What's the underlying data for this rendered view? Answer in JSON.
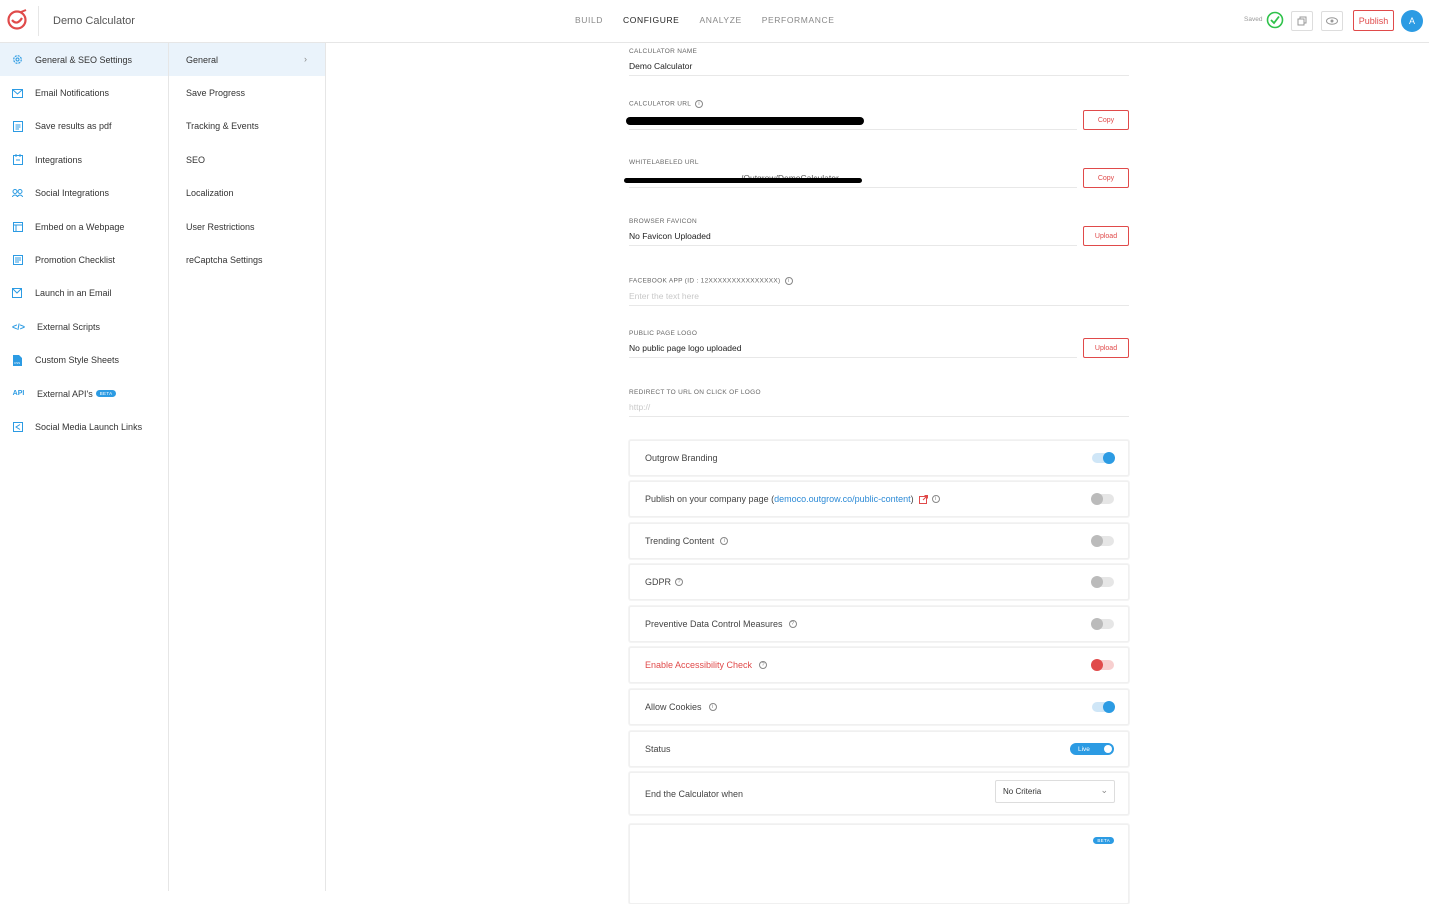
{
  "app": {
    "title": "Demo Calculator"
  },
  "nav": {
    "tabs": [
      "BUILD",
      "CONFIGURE",
      "ANALYZE",
      "PERFORMANCE"
    ],
    "active": "CONFIGURE"
  },
  "status": {
    "saved": "Saved"
  },
  "actions": {
    "publish": "Publish",
    "avatar": "A"
  },
  "sidebar": {
    "items": [
      {
        "label": "General & SEO Settings",
        "icon": "gear-icon"
      },
      {
        "label": "Email Notifications",
        "icon": "mail-icon"
      },
      {
        "label": "Save results as pdf",
        "icon": "pdf-icon"
      },
      {
        "label": "Integrations",
        "icon": "integrations-icon"
      },
      {
        "label": "Social Integrations",
        "icon": "social-icon"
      },
      {
        "label": "Embed on a Webpage",
        "icon": "embed-icon"
      },
      {
        "label": "Promotion Checklist",
        "icon": "checklist-icon"
      },
      {
        "label": "Launch in an Email",
        "icon": "launch-mail-icon"
      },
      {
        "label": "External Scripts",
        "icon": "code-icon"
      },
      {
        "label": "Custom Style Sheets",
        "icon": "css-icon"
      },
      {
        "label": "External API's",
        "icon": "api-icon",
        "badge": "BETA"
      },
      {
        "label": "Social Media Launch Links",
        "icon": "share-icon"
      }
    ]
  },
  "subnav": {
    "items": [
      "General",
      "Save Progress",
      "Tracking & Events",
      "SEO",
      "Localization",
      "User Restrictions",
      "reCaptcha Settings"
    ]
  },
  "form": {
    "calculator_name_label": "CALCULATOR NAME",
    "calculator_name_value": "Demo Calculator",
    "calculator_url_label": "CALCULATOR URL",
    "copy": "Copy",
    "whitelabeled_url_label": "WHITELABELED URL",
    "whitelabeled_url_suffix": "/Outgrow/DemoCalculator",
    "browser_favicon_label": "BROWSER FAVICON",
    "browser_favicon_value": "No Favicon Uploaded",
    "upload": "Upload",
    "facebook_app_label": "FACEBOOK APP (ID : 12XXXXXXXXXXXXXXX)",
    "facebook_app_placeholder": "Enter the text here",
    "public_page_logo_label": "PUBLIC PAGE LOGO",
    "public_page_logo_value": "No public page logo uploaded",
    "redirect_label": "REDIRECT TO URL ON CLICK OF LOGO",
    "redirect_placeholder": "http://"
  },
  "toggles": {
    "outgrow_branding": "Outgrow Branding",
    "publish_company_prefix": "Publish on your company page (",
    "publish_company_link": "democo.outgrow.co/public-content",
    "publish_company_suffix": ")",
    "trending_content": "Trending Content",
    "gdpr": "GDPR",
    "preventive": "Preventive Data Control Measures",
    "accessibility": "Enable Accessibility Check",
    "allow_cookies": "Allow Cookies",
    "status": "Status",
    "status_value": "Live",
    "end_when": "End the Calculator when",
    "end_when_value": "No Criteria",
    "beta": "BETA"
  },
  "colors": {
    "accent": "#2c9be3",
    "danger": "#e04a4a",
    "success": "#2ec24a"
  }
}
